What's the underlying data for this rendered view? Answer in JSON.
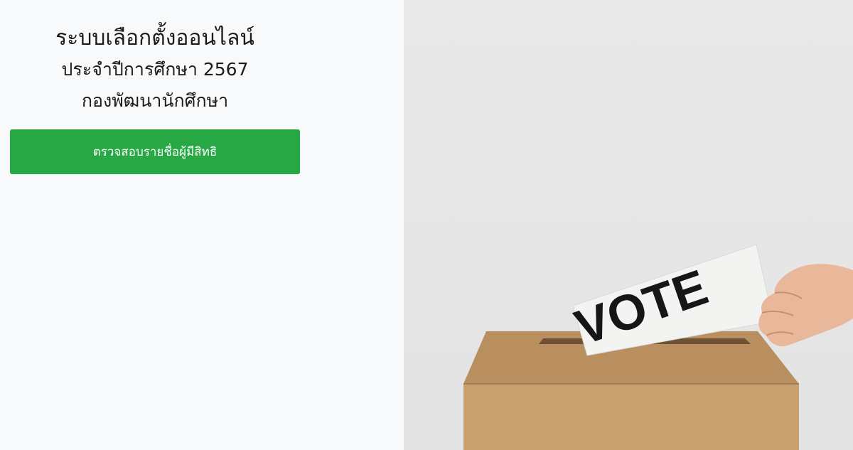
{
  "header": {
    "title": "ระบบเลือกตั้งออนไลน์",
    "subtitle": "ประจำปีการศึกษา 2567",
    "organization": "กองพัฒนานักศึกษา"
  },
  "actions": {
    "check_eligible_label": "ตรวจสอบรายชื่อผู้มีสิทธิ"
  },
  "hero": {
    "ballot_text": "VOTE"
  },
  "colors": {
    "button": "#28a745",
    "background_left": "#f8f9fb",
    "box": "#c9a06f"
  }
}
